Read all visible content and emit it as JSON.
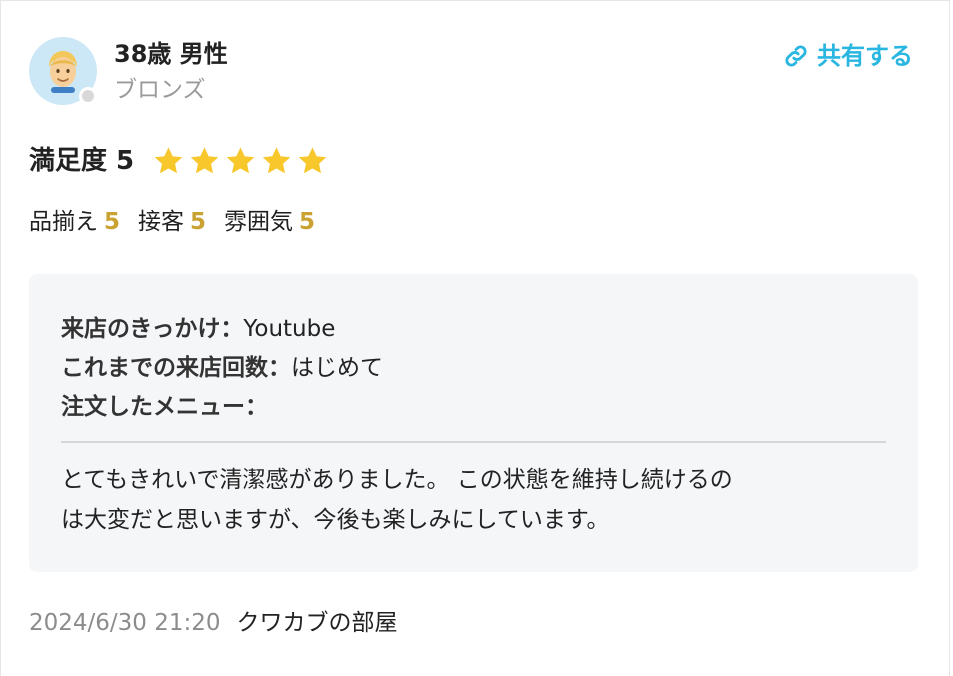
{
  "reviewer": {
    "name": "38歳 男性",
    "rank": "ブロンズ",
    "avatar_icon": "man-face-icon"
  },
  "share": {
    "label": "共有する",
    "icon": "link-icon",
    "color": "#29b6e0"
  },
  "rating": {
    "label": "満足度 5",
    "stars": 5,
    "max_stars": 5,
    "star_color": "#f7c72b"
  },
  "sub_ratings": [
    {
      "label": "品揃え",
      "value": "5"
    },
    {
      "label": "接客",
      "value": "5"
    },
    {
      "label": "雰囲気",
      "value": "5"
    }
  ],
  "details": {
    "trigger_label": "来店のきっかけ：",
    "trigger_value": "Youtube",
    "visits_label": "これまでの来店回数：",
    "visits_value": "はじめて",
    "menu_label": "注文したメニュー：",
    "menu_value": ""
  },
  "comment": {
    "line1": "とてもきれいで清潔感がありました。 この状態を維持し続けるの",
    "line2": "は大変だと思いますが、今後も楽しみにしています。"
  },
  "footer": {
    "date": "2024/6/30 21:20",
    "shop": "クワカブの部屋"
  }
}
